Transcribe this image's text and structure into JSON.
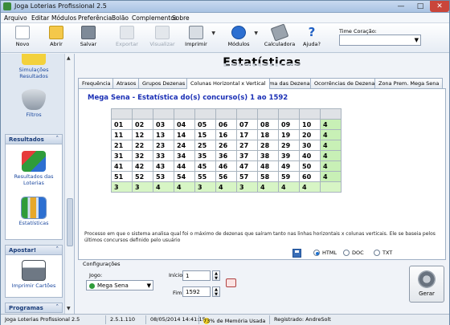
{
  "window": {
    "title": "Joga Loterias Profissional 2.5"
  },
  "menu": [
    "Arquivo",
    "Editar",
    "Módulos",
    "Preferência",
    "Bolão",
    "Complementos",
    "Sobre"
  ],
  "toolbar": {
    "buttons": [
      {
        "label": "Novo",
        "icon": "new-document-icon",
        "enabled": true
      },
      {
        "label": "Abrir",
        "icon": "open-folder-icon",
        "enabled": true
      },
      {
        "label": "Salvar",
        "icon": "save-disk-icon",
        "enabled": true
      },
      {
        "label": "Exportar",
        "icon": "export-icon",
        "enabled": false
      },
      {
        "label": "Visualizar",
        "icon": "preview-icon",
        "enabled": false
      },
      {
        "label": "Imprimir",
        "icon": "printer-icon",
        "enabled": true
      },
      {
        "label": "Módulos",
        "icon": "modules-gear-icon",
        "enabled": true
      },
      {
        "label": "Calculadora",
        "icon": "calculator-icon",
        "enabled": true
      },
      {
        "label": "Ajuda?",
        "icon": "help-icon",
        "enabled": true
      }
    ],
    "time_label": "Time Coração:",
    "time_value": ""
  },
  "sidebar": {
    "items_top": [
      {
        "label": "Simulações Resultados"
      },
      {
        "label": "Filtros"
      }
    ],
    "groups": [
      {
        "title": "Resultados",
        "items": [
          {
            "label": "Resultados das Loterias"
          },
          {
            "label": "Estatísticas"
          }
        ]
      },
      {
        "title": "Apostar!",
        "items": [
          {
            "label": "Imprimir Cartões"
          }
        ]
      },
      {
        "title": "Programas",
        "items": []
      }
    ]
  },
  "main": {
    "heading": "Estatísticas",
    "tabs": [
      "Frequência",
      "Atrasos",
      "Grupos Dezenas",
      "Colunas Horizontal x Vertical",
      "Soma das Dezenas",
      "Ocorrências de Dezenas",
      "Zona Prem. Mega Sena"
    ],
    "active_tab": "Colunas Horizontal x Vertical",
    "panel_title": "Mega Sena - Estatística do(s) concurso(s) 1 ao 1592",
    "grid": {
      "rows": [
        [
          "01",
          "02",
          "03",
          "04",
          "05",
          "06",
          "07",
          "08",
          "09",
          "10",
          "4"
        ],
        [
          "11",
          "12",
          "13",
          "14",
          "15",
          "16",
          "17",
          "18",
          "19",
          "20",
          "4"
        ],
        [
          "21",
          "22",
          "23",
          "24",
          "25",
          "26",
          "27",
          "28",
          "29",
          "30",
          "4"
        ],
        [
          "31",
          "32",
          "33",
          "34",
          "35",
          "36",
          "37",
          "38",
          "39",
          "40",
          "4"
        ],
        [
          "41",
          "42",
          "43",
          "44",
          "45",
          "46",
          "47",
          "48",
          "49",
          "50",
          "4"
        ],
        [
          "51",
          "52",
          "53",
          "54",
          "55",
          "56",
          "57",
          "58",
          "59",
          "60",
          "4"
        ]
      ],
      "column_totals": [
        "3",
        "3",
        "4",
        "4",
        "3",
        "4",
        "3",
        "4",
        "4",
        "4",
        ""
      ]
    },
    "description": "Processo em que o sistema analisa qual foi o máximo de dezenas que saíram tanto nas linhas horizontais x colunas verticais. Ele se baseia pelos últimos concursos definido pelo usuário",
    "formats": [
      {
        "label": "HTML",
        "selected": true
      },
      {
        "label": "DOC",
        "selected": false
      },
      {
        "label": "TXT",
        "selected": false
      }
    ],
    "config": {
      "title": "Configurações",
      "jogo_label": "Jogo:",
      "jogo_value": "Mega Sena",
      "inicio_label": "Início",
      "inicio_value": "1",
      "fim_label": "Fim",
      "fim_value": "1592",
      "gerar_label": "Gerar"
    }
  },
  "status": {
    "app": "Joga Loterias Profissional 2.5",
    "version": "2.5.1.110",
    "datetime": "08/05/2014 14:41:15",
    "memory": "73% de Memória Usada",
    "registered": "Registrado: AndreSolt"
  },
  "colors": {
    "accent_title": "#1a2fb5",
    "sum_row": "#d7f5c5",
    "close_button": "#c9453a"
  }
}
